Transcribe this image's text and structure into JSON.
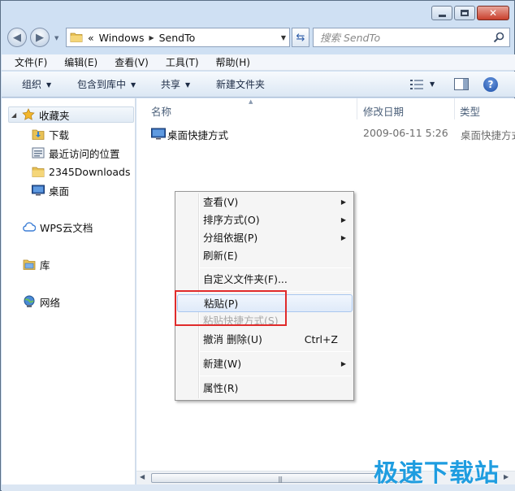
{
  "window": {
    "buttons": {
      "minimize": "minimize-icon",
      "maximize": "maximize-icon",
      "close": "close-icon"
    }
  },
  "address": {
    "overflow": "«",
    "crumbs": [
      "Windows",
      "SendTo"
    ],
    "search_placeholder": "搜索 SendTo"
  },
  "menubar": [
    "文件(F)",
    "编辑(E)",
    "查看(V)",
    "工具(T)",
    "帮助(H)"
  ],
  "toolbar": {
    "organize": "组织",
    "include_in_library": "包含到库中",
    "share": "共享",
    "new_folder": "新建文件夹"
  },
  "navpane": {
    "favorites": "收藏夹",
    "favorite_items": [
      "下载",
      "最近访问的位置",
      "2345Downloads",
      "桌面"
    ],
    "wps": "WPS云文档",
    "libraries": "库",
    "network": "网络"
  },
  "columns": {
    "name": "名称",
    "date": "修改日期",
    "type": "类型"
  },
  "files": [
    {
      "name": "桌面快捷方式",
      "date": "2009-06-11 5:26",
      "type": "桌面快捷方式"
    }
  ],
  "context_menu": {
    "view": "查看(V)",
    "sort": "排序方式(O)",
    "group": "分组依据(P)",
    "refresh": "刷新(E)",
    "customize": "自定义文件夹(F)...",
    "paste": "粘贴(P)",
    "paste_shortcut": "粘贴快捷方式(S)",
    "undo": "撤消 删除(U)",
    "undo_shortcut": "Ctrl+Z",
    "new": "新建(W)",
    "properties": "属性(R)"
  },
  "watermark": "极速下载站",
  "colors": {
    "highlight": "#e02b2b",
    "watermark": "#1f9de0",
    "frame": "#cfe0f3"
  }
}
